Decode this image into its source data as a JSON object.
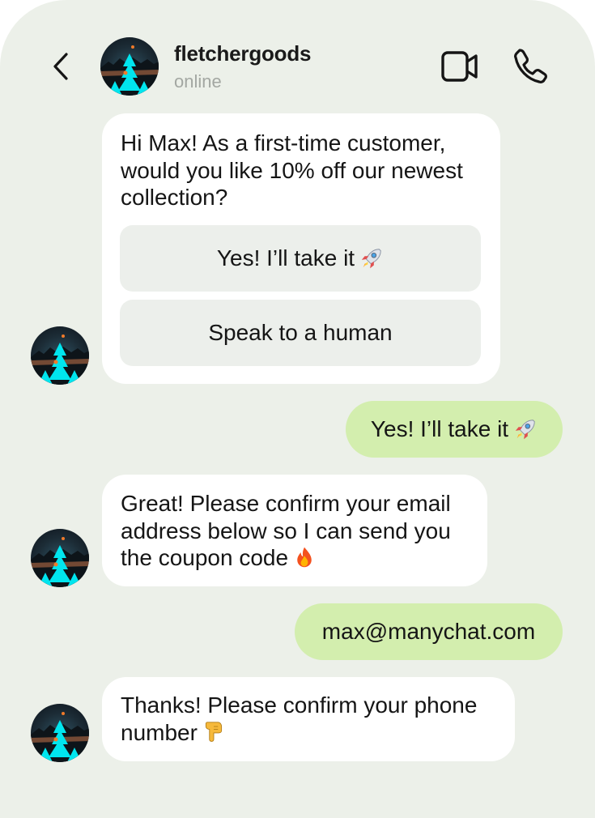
{
  "header": {
    "back_icon": "chevron-left-icon",
    "contact_name": "fletchergoods",
    "status": "online",
    "video_icon": "video-camera-icon",
    "phone_icon": "phone-icon"
  },
  "messages": [
    {
      "from": "business",
      "text": "Hi Max! As a first-time customer,\nwould you like 10% off our newest\ncollection?",
      "quick_replies": [
        {
          "label": "Yes! I’ll take it",
          "icon": "rocket-emoji"
        },
        {
          "label": "Speak to a human"
        }
      ]
    },
    {
      "from": "user",
      "text": "Yes! I’ll take it",
      "icon": "rocket-emoji"
    },
    {
      "from": "business",
      "text": "Great! Please confirm your email\naddress below so I can send you\nthe coupon code",
      "icon": "fire-emoji"
    },
    {
      "from": "user",
      "text": "max@manychat.com"
    },
    {
      "from": "business",
      "text": "Thanks! Please confirm your phone\nnumber",
      "icon": "pointing-down-emoji"
    }
  ],
  "colors": {
    "background": "#ecf0e9",
    "incoming_bubble": "#ffffff",
    "outgoing_bubble": "#d3eeae",
    "quick_reply_button": "#ecefeb",
    "accent_cyan": "#00e5ee"
  }
}
